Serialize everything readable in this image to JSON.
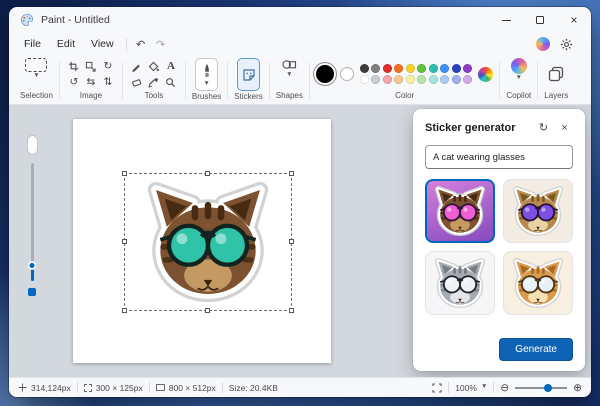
{
  "window": {
    "title": "Paint - Untitled"
  },
  "menu": {
    "items": [
      "File",
      "Edit",
      "View"
    ]
  },
  "ribbon": {
    "groups": {
      "selection": "Selection",
      "image": "Image",
      "tools": "Tools",
      "brushes": "Brushes",
      "stickers": "Stickers",
      "shapes": "Shapes",
      "color": "Color",
      "copilot": "Copilot",
      "layers": "Layers"
    },
    "palette": {
      "primary": "#000000",
      "secondary": "#ffffff",
      "row1": [
        "#3d3d3d",
        "#808080",
        "#e22b2b",
        "#f4701f",
        "#f5d327",
        "#61c23c",
        "#2fbdb3",
        "#3e8ff3",
        "#2a43c0",
        "#8a3fc6"
      ],
      "row2": [
        "#ffffff",
        "#c9cdd2",
        "#f2a5ad",
        "#f8c695",
        "#faf0a0",
        "#b9e5a2",
        "#a6e4df",
        "#a9ccf5",
        "#9fadea",
        "#d5a8ea"
      ]
    }
  },
  "sticker_panel": {
    "title": "Sticker generator",
    "prompt": "A cat wearing glasses",
    "generate_label": "Generate",
    "thumbnails": [
      {
        "name": "tabby cat with pink sunglasses",
        "bg": "#a868d8",
        "selected": true
      },
      {
        "name": "tan cat with purple sunglasses",
        "bg": "#f3ece2",
        "selected": false
      },
      {
        "name": "gray cat with round glasses",
        "bg": "#f6f6f8",
        "selected": false
      },
      {
        "name": "orange cat with round glasses",
        "bg": "#f7efdf",
        "selected": false
      }
    ]
  },
  "canvas_sticker": {
    "name": "tabby cat with teal sunglasses"
  },
  "status": {
    "cursor": "314,124px",
    "selection": "300 × 125px",
    "canvas": "800 × 512px",
    "file_size": "Size: 20.4KB",
    "zoom": "100%"
  },
  "accent": "#0067c0"
}
